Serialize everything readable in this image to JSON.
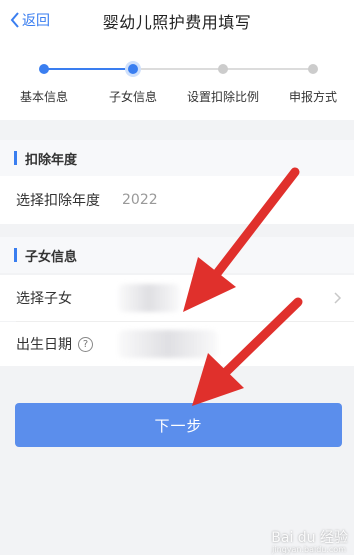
{
  "header": {
    "back_label": "返回",
    "title": "婴幼儿照护费用填写"
  },
  "steps": [
    {
      "label": "基本信息",
      "state": "done"
    },
    {
      "label": "子女信息",
      "state": "current"
    },
    {
      "label": "设置扣除比例",
      "state": "todo"
    },
    {
      "label": "申报方式",
      "state": "todo"
    }
  ],
  "sections": {
    "deduction_year": {
      "title": "扣除年度",
      "row_label": "选择扣除年度",
      "row_value": "2022"
    },
    "child_info": {
      "title": "子女信息",
      "select_child_label": "选择子女",
      "birth_date_label": "出生日期",
      "help_glyph": "?"
    }
  },
  "next_button_label": "下一步",
  "watermark": {
    "text": "Bai du 经验",
    "sub": "jingyan.baidu.com"
  },
  "colors": {
    "accent": "#3a7ef0",
    "button": "#5b8eec",
    "annotation_arrow": "#e0302c",
    "step_todo": "#cccccc"
  }
}
